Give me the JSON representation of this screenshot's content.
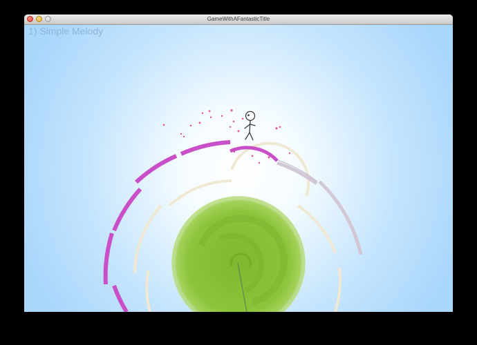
{
  "window": {
    "title": "GameWithAFantasticTitle"
  },
  "hud": {
    "level_label": "1) Simple Melody"
  },
  "colors": {
    "ring_active": "#c94fc8",
    "ring_inactive": "#d2c7d4",
    "ring_faded": "#efe8d2",
    "planet": "#8cc43a",
    "sky": "#a9d6fb",
    "particles": "#e6559a"
  },
  "icons": {
    "player": "stick-figure",
    "window_controls": [
      "close-icon",
      "minimize-icon",
      "zoom-icon"
    ]
  }
}
